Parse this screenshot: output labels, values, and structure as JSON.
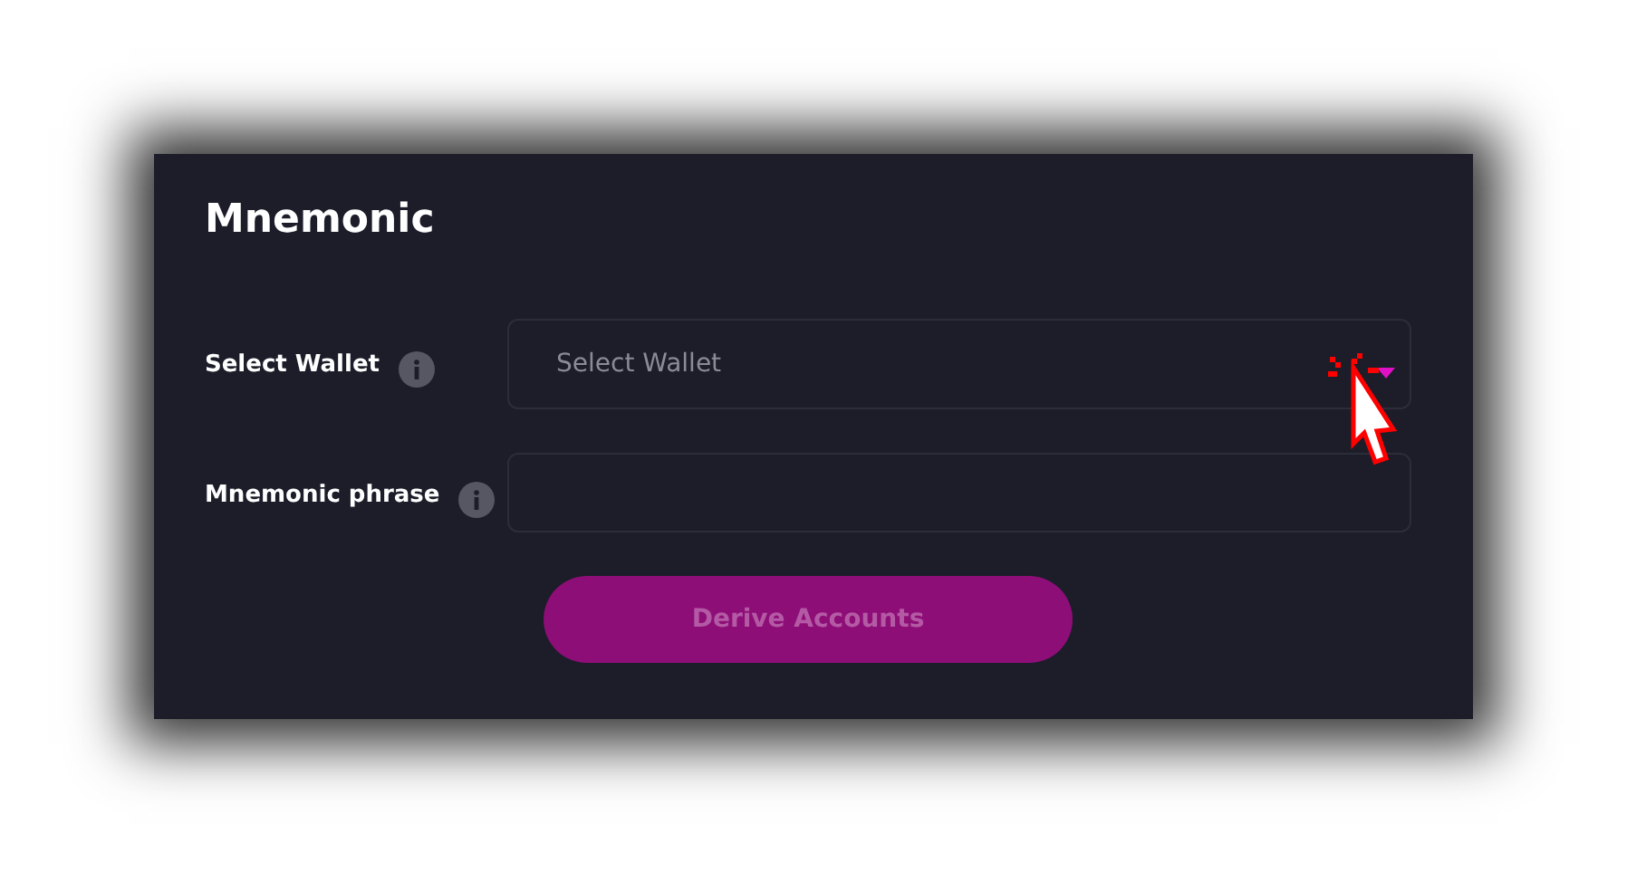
{
  "title": "Mnemonic",
  "fields": [
    {
      "kind": "select",
      "label": "Select Wallet",
      "placeholder": "Select Wallet"
    },
    {
      "kind": "text",
      "label": "Mnemonic phrase"
    }
  ],
  "button": {
    "label": "Derive Accounts",
    "disabled": true
  }
}
